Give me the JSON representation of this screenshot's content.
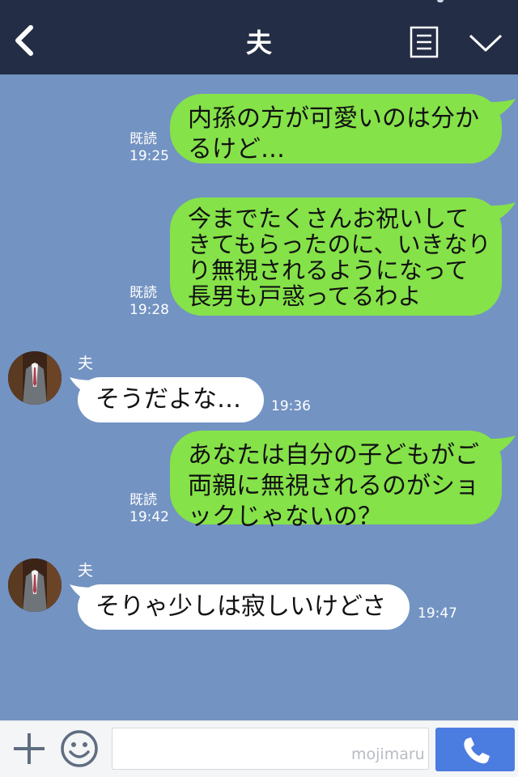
{
  "header": {
    "title": "夫",
    "back_icon": "chevron-left-icon",
    "menu_icon": "list-icon",
    "collapse_icon": "chevron-down-icon"
  },
  "messages": [
    {
      "direction": "out",
      "text": "内孫の方が可愛いのは分かるけど…",
      "read": "既読",
      "time": "19:25"
    },
    {
      "direction": "out",
      "text": "今までたくさんお祝いしてきてもらったのに、いきなり無視されるようになって長男も戸惑ってるわよ",
      "read": "既読",
      "time": "19:28"
    },
    {
      "direction": "in",
      "sender": "夫",
      "text": "そうだよな…",
      "time": "19:36"
    },
    {
      "direction": "out",
      "text": "あなたは自分の子どもがご両親に無視されるのがショックじゃないの？",
      "read": "既読",
      "time": "19:42"
    },
    {
      "direction": "in",
      "sender": "夫",
      "text": "そりゃ少しは寂しいけどさ",
      "time": "19:47"
    }
  ],
  "lines": {
    "m0": [
      "内孫の方が可愛いのは分か",
      "るけど…"
    ],
    "m1": [
      "今までたくさんお祝いして",
      "きてもらったのに、いきなり",
      "り無視されるようになって",
      "長男も戸惑ってるわよ"
    ],
    "m3": [
      "あなたは自分の子どもがご",
      "両親に無視されるのがショ",
      "ックじゃないの？"
    ]
  },
  "input": {
    "placeholder": "",
    "watermark": "mojimaru",
    "plus_icon": "plus-icon",
    "emoji_icon": "smiley-icon",
    "call_icon": "phone-icon"
  },
  "colors": {
    "header_bg": "#232d45",
    "chat_bg": "#7393c2",
    "outgoing_bubble": "#85e249",
    "incoming_bubble": "#ffffff",
    "call_button": "#4b7ce0"
  }
}
